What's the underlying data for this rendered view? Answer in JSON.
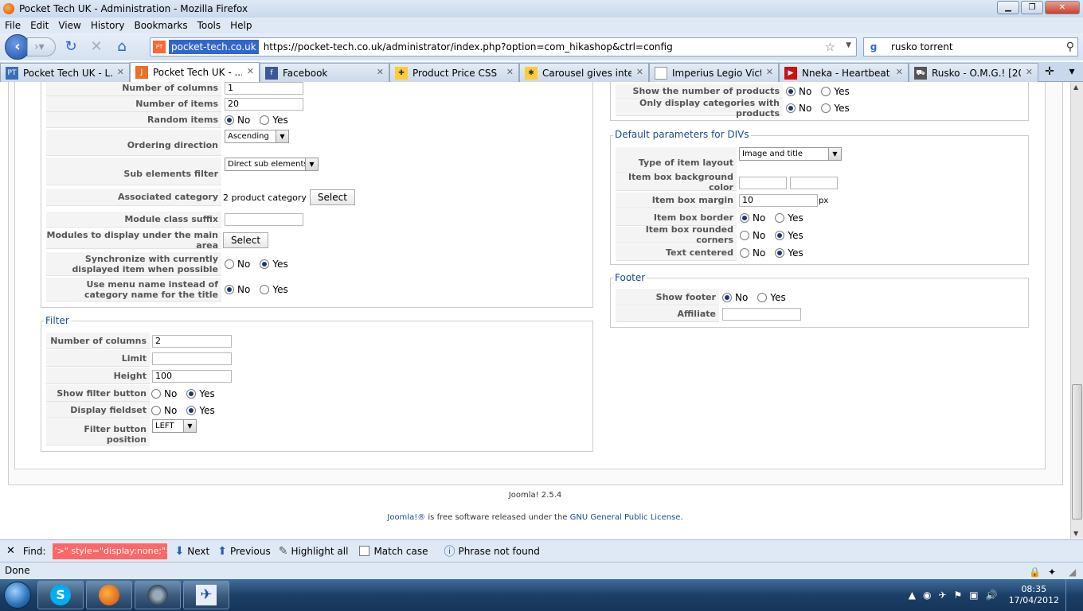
{
  "window": {
    "title": "Pocket Tech UK - Administration - Mozilla Firefox"
  },
  "menu": [
    "File",
    "Edit",
    "View",
    "History",
    "Bookmarks",
    "Tools",
    "Help"
  ],
  "nav": {
    "site_badge": "pocket-tech.co.uk",
    "url": "https://pocket-tech.co.uk/administrator/index.php?option=com_hikashop&ctrl=config",
    "search_value": "rusko torrent"
  },
  "tabs": [
    {
      "label": "Pocket Tech UK - L...",
      "active": false
    },
    {
      "label": "Pocket Tech UK - ...",
      "active": true
    },
    {
      "label": "Facebook",
      "active": false
    },
    {
      "label": "Product Price CSS",
      "active": false
    },
    {
      "label": "Carousel gives inte...",
      "active": false
    },
    {
      "label": "Imperius Legio Vict...",
      "active": false
    },
    {
      "label": "Nneka - Heartbeat ...",
      "active": false
    },
    {
      "label": "Rusko - O.M.G.! [20...",
      "active": false
    }
  ],
  "left_top": {
    "number_of_columns": {
      "label": "Number of columns",
      "value": "1"
    },
    "number_of_items": {
      "label": "Number of items",
      "value": "20"
    },
    "random_items": {
      "label": "Random items"
    },
    "ordering_direction": {
      "label": "Ordering direction",
      "value": "Ascending"
    },
    "sub_elements_filter": {
      "label": "Sub elements filter",
      "value": "Direct sub elements"
    },
    "associated_category": {
      "label": "Associated category",
      "value": "2 product category",
      "button": "Select"
    },
    "module_class_suffix": {
      "label": "Module class suffix",
      "value": ""
    },
    "modules_under_main": {
      "label": "Modules to display under the main area",
      "button": "Select"
    },
    "synchronize": {
      "label1": "Synchronize with currently",
      "label2": "displayed item when possible"
    },
    "use_menu_name": {
      "label1": "Use menu name instead of",
      "label2": "category name for the title"
    }
  },
  "options": {
    "no": "No",
    "yes": "Yes"
  },
  "filter": {
    "legend": "Filter",
    "number_of_columns": {
      "label": "Number of columns",
      "value": "2"
    },
    "limit": {
      "label": "Limit",
      "value": ""
    },
    "height": {
      "label": "Height",
      "value": "100"
    },
    "show_filter_button": {
      "label": "Show filter button"
    },
    "display_fieldset": {
      "label": "Display fieldset"
    },
    "filter_button_position": {
      "label": "Filter button position",
      "value": "LEFT"
    }
  },
  "right_top": {
    "show_number_products": {
      "label": "Show the number of products"
    },
    "only_display_categories": {
      "label": "Only display categories with products"
    }
  },
  "divs": {
    "legend": "Default parameters for DIVs",
    "type_of_item_layout": {
      "label": "Type of item layout",
      "value": "Image and title"
    },
    "item_box_bg_color": {
      "label": "Item box background color"
    },
    "item_box_margin": {
      "label": "Item box margin",
      "value": "10",
      "unit": "px"
    },
    "item_box_border": {
      "label": "Item box border"
    },
    "item_box_rounded": {
      "label": "Item box rounded corners"
    },
    "text_centered": {
      "label": "Text centered"
    }
  },
  "footer_fs": {
    "legend": "Footer",
    "show_footer": {
      "label": "Show footer"
    },
    "affiliate": {
      "label": "Affiliate",
      "value": ""
    }
  },
  "page_footer": {
    "version": "Joomla! 2.5.4",
    "license_prefix": "Joomla!®",
    "license_mid": " is free software released under the ",
    "license_link": "GNU General Public License",
    "license_end": "."
  },
  "findbar": {
    "label": "Find:",
    "value": "'>\" style=\"display:none;\">",
    "next": "Next",
    "previous": "Previous",
    "highlight": "Highlight all",
    "match_case": "Match case",
    "status": "Phrase not found"
  },
  "status": {
    "text": "Done"
  },
  "clock": {
    "time": "08:35",
    "date": "17/04/2012"
  }
}
